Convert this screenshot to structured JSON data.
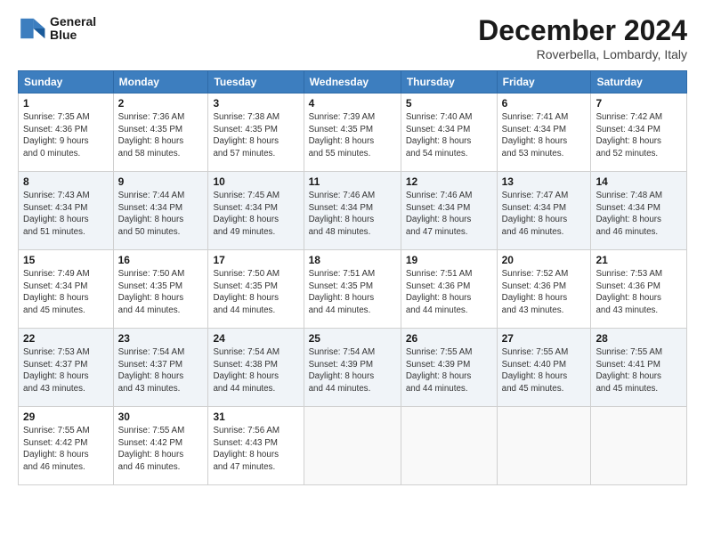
{
  "header": {
    "logo_line1": "General",
    "logo_line2": "Blue",
    "month": "December 2024",
    "location": "Roverbella, Lombardy, Italy"
  },
  "weekdays": [
    "Sunday",
    "Monday",
    "Tuesday",
    "Wednesday",
    "Thursday",
    "Friday",
    "Saturday"
  ],
  "weeks": [
    [
      {
        "day": "1",
        "sunrise": "7:35 AM",
        "sunset": "4:36 PM",
        "daylight": "9 hours and 0 minutes."
      },
      {
        "day": "2",
        "sunrise": "7:36 AM",
        "sunset": "4:35 PM",
        "daylight": "8 hours and 58 minutes."
      },
      {
        "day": "3",
        "sunrise": "7:38 AM",
        "sunset": "4:35 PM",
        "daylight": "8 hours and 57 minutes."
      },
      {
        "day": "4",
        "sunrise": "7:39 AM",
        "sunset": "4:35 PM",
        "daylight": "8 hours and 55 minutes."
      },
      {
        "day": "5",
        "sunrise": "7:40 AM",
        "sunset": "4:34 PM",
        "daylight": "8 hours and 54 minutes."
      },
      {
        "day": "6",
        "sunrise": "7:41 AM",
        "sunset": "4:34 PM",
        "daylight": "8 hours and 53 minutes."
      },
      {
        "day": "7",
        "sunrise": "7:42 AM",
        "sunset": "4:34 PM",
        "daylight": "8 hours and 52 minutes."
      }
    ],
    [
      {
        "day": "8",
        "sunrise": "7:43 AM",
        "sunset": "4:34 PM",
        "daylight": "8 hours and 51 minutes."
      },
      {
        "day": "9",
        "sunrise": "7:44 AM",
        "sunset": "4:34 PM",
        "daylight": "8 hours and 50 minutes."
      },
      {
        "day": "10",
        "sunrise": "7:45 AM",
        "sunset": "4:34 PM",
        "daylight": "8 hours and 49 minutes."
      },
      {
        "day": "11",
        "sunrise": "7:46 AM",
        "sunset": "4:34 PM",
        "daylight": "8 hours and 48 minutes."
      },
      {
        "day": "12",
        "sunrise": "7:46 AM",
        "sunset": "4:34 PM",
        "daylight": "8 hours and 47 minutes."
      },
      {
        "day": "13",
        "sunrise": "7:47 AM",
        "sunset": "4:34 PM",
        "daylight": "8 hours and 46 minutes."
      },
      {
        "day": "14",
        "sunrise": "7:48 AM",
        "sunset": "4:34 PM",
        "daylight": "8 hours and 46 minutes."
      }
    ],
    [
      {
        "day": "15",
        "sunrise": "7:49 AM",
        "sunset": "4:34 PM",
        "daylight": "8 hours and 45 minutes."
      },
      {
        "day": "16",
        "sunrise": "7:50 AM",
        "sunset": "4:35 PM",
        "daylight": "8 hours and 44 minutes."
      },
      {
        "day": "17",
        "sunrise": "7:50 AM",
        "sunset": "4:35 PM",
        "daylight": "8 hours and 44 minutes."
      },
      {
        "day": "18",
        "sunrise": "7:51 AM",
        "sunset": "4:35 PM",
        "daylight": "8 hours and 44 minutes."
      },
      {
        "day": "19",
        "sunrise": "7:51 AM",
        "sunset": "4:36 PM",
        "daylight": "8 hours and 44 minutes."
      },
      {
        "day": "20",
        "sunrise": "7:52 AM",
        "sunset": "4:36 PM",
        "daylight": "8 hours and 43 minutes."
      },
      {
        "day": "21",
        "sunrise": "7:53 AM",
        "sunset": "4:36 PM",
        "daylight": "8 hours and 43 minutes."
      }
    ],
    [
      {
        "day": "22",
        "sunrise": "7:53 AM",
        "sunset": "4:37 PM",
        "daylight": "8 hours and 43 minutes."
      },
      {
        "day": "23",
        "sunrise": "7:54 AM",
        "sunset": "4:37 PM",
        "daylight": "8 hours and 43 minutes."
      },
      {
        "day": "24",
        "sunrise": "7:54 AM",
        "sunset": "4:38 PM",
        "daylight": "8 hours and 44 minutes."
      },
      {
        "day": "25",
        "sunrise": "7:54 AM",
        "sunset": "4:39 PM",
        "daylight": "8 hours and 44 minutes."
      },
      {
        "day": "26",
        "sunrise": "7:55 AM",
        "sunset": "4:39 PM",
        "daylight": "8 hours and 44 minutes."
      },
      {
        "day": "27",
        "sunrise": "7:55 AM",
        "sunset": "4:40 PM",
        "daylight": "8 hours and 45 minutes."
      },
      {
        "day": "28",
        "sunrise": "7:55 AM",
        "sunset": "4:41 PM",
        "daylight": "8 hours and 45 minutes."
      }
    ],
    [
      {
        "day": "29",
        "sunrise": "7:55 AM",
        "sunset": "4:42 PM",
        "daylight": "8 hours and 46 minutes."
      },
      {
        "day": "30",
        "sunrise": "7:55 AM",
        "sunset": "4:42 PM",
        "daylight": "8 hours and 46 minutes."
      },
      {
        "day": "31",
        "sunrise": "7:56 AM",
        "sunset": "4:43 PM",
        "daylight": "8 hours and 47 minutes."
      },
      null,
      null,
      null,
      null
    ]
  ]
}
